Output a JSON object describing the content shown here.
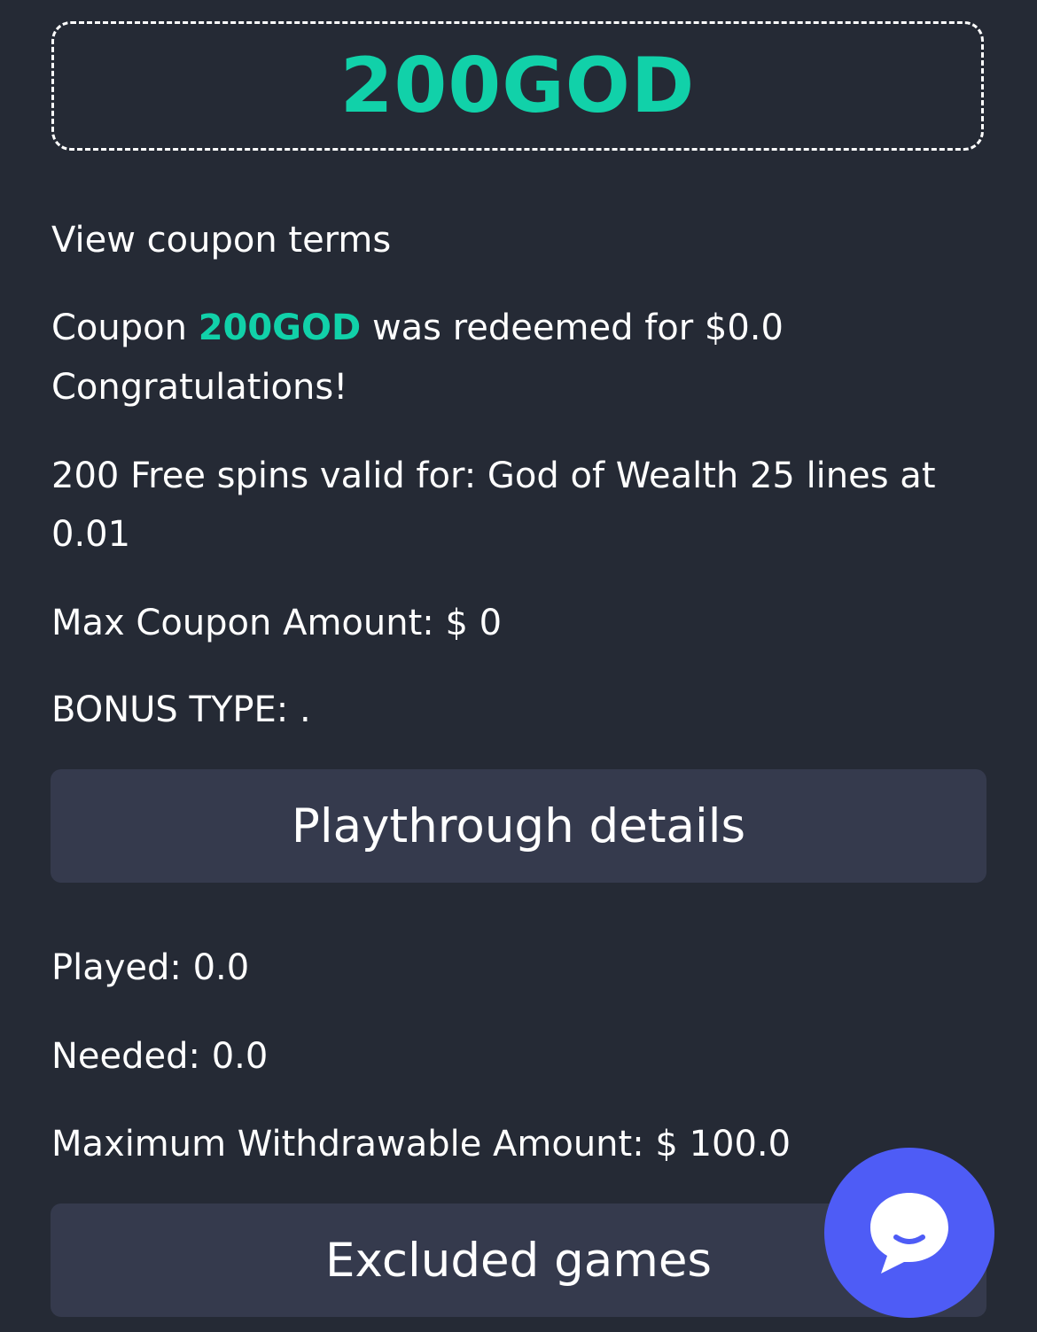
{
  "coupon": {
    "code": "200GOD"
  },
  "terms": {
    "view_terms_label": "View coupon terms",
    "redeemed_prefix": "Coupon ",
    "redeemed_code": "200GOD",
    "redeemed_suffix": " was redeemed for $0.0",
    "congratulations": "Congratulations!",
    "free_spins_line1": "200 Free spins valid for: God of Wealth 25 lines at",
    "free_spins_line2": "0.01",
    "max_coupon_amount": "Max Coupon Amount: $ 0",
    "bonus_type": "BONUS TYPE: ."
  },
  "playthrough": {
    "button_label": "Playthrough details",
    "played": "Played: 0.0",
    "needed": "Needed: 0.0",
    "max_withdrawable": "Maximum Withdrawable Amount: $ 100.0"
  },
  "excluded": {
    "button_label": "Excluded games"
  },
  "chat": {
    "icon": "chat-bubble-icon"
  },
  "colors": {
    "background": "#252a35",
    "accent": "#11d1a9",
    "panel": "#353a4d",
    "chat_button": "#4e5cf6"
  }
}
